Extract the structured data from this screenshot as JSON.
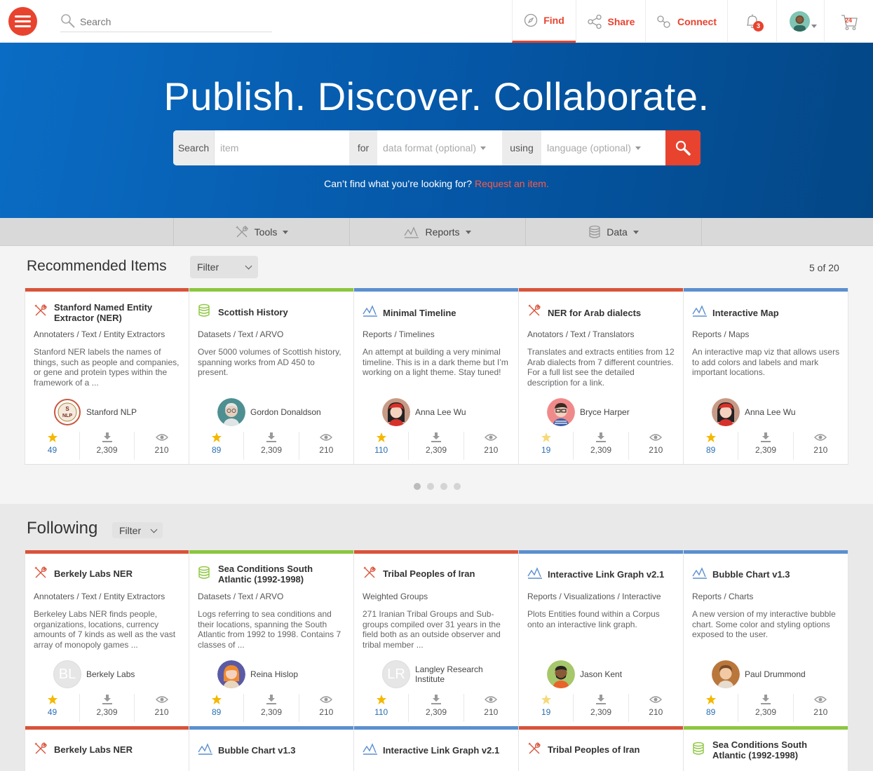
{
  "header": {
    "search_placeholder": "Search",
    "tabs": [
      {
        "label": "Find",
        "icon": "compass-icon"
      },
      {
        "label": "Share",
        "icon": "share-icon"
      },
      {
        "label": "Connect",
        "icon": "link-icon"
      }
    ],
    "notification_count": "3",
    "cart_count": "24"
  },
  "hero": {
    "title": "Publish. Discover. Collaborate.",
    "search_label": "Search",
    "item_placeholder": "item",
    "for_label": "for",
    "format_placeholder": "data format (optional)",
    "using_label": "using",
    "language_placeholder": "language (optional)",
    "note": "Can’t find what you’re looking for?",
    "note_link": "Request an item."
  },
  "categories": [
    {
      "label": "Tools",
      "icon": "tools-icon"
    },
    {
      "label": "Reports",
      "icon": "chart-line-icon"
    },
    {
      "label": "Data",
      "icon": "database-icon"
    }
  ],
  "recommended": {
    "title": "Recommended Items",
    "filter_label": "Filter",
    "counter": "5 of 20",
    "cards": [
      {
        "title": "Stanford Named Entity Extractor (NER)",
        "category": "Annotaters / Text / Entity Extractors",
        "desc": "Stanford NER labels the names of things, such as people and companies, or gene and protein types within the framework of a ...",
        "author": "Stanford NLP",
        "stars": "49",
        "downloads": "2,309",
        "views": "210"
      },
      {
        "title": "Scottish History",
        "category": "Datasets / Text / ARVO",
        "desc": "Over 5000 volumes of Scottish history, spanning works from AD 450 to present.",
        "author": "Gordon Donaldson",
        "stars": "89",
        "downloads": "2,309",
        "views": "210"
      },
      {
        "title": "Minimal Timeline",
        "category": "Reports / Timelines",
        "desc": "An attempt at building a very minimal timeline. This is in a dark theme but I’m working on a light theme. Stay tuned!",
        "author": "Anna Lee Wu",
        "stars": "110",
        "downloads": "2,309",
        "views": "210"
      },
      {
        "title": "NER for Arab dialects",
        "category": "Anotators / Text / Translators",
        "desc": "Translates and extracts entities from 12 Arab dialects from 7 different countries. For a full list see the detailed description for a link.",
        "author": "Bryce Harper",
        "stars": "19",
        "downloads": "2,309",
        "views": "210"
      },
      {
        "title": "Interactive Map",
        "category": "Reports / Maps",
        "desc": "An interactive map viz that allows users to add colors and labels and mark important locations.",
        "author": "Anna Lee Wu",
        "stars": "89",
        "downloads": "2,309",
        "views": "210"
      }
    ]
  },
  "following": {
    "title": "Following",
    "filter_label": "Filter",
    "cards": [
      {
        "title": "Berkely Labs NER",
        "category": "Annotaters / Text / Entity Extractors",
        "desc": "Berkeley Labs NER finds people, organizations, locations, currency amounts of 7 kinds as well as the vast array of monopoly games ...",
        "author": "Berkely Labs",
        "initials": "BL",
        "stars": "49",
        "downloads": "2,309",
        "views": "210"
      },
      {
        "title": "Sea Conditions South Atlantic (1992-1998)",
        "category": "Datasets / Text / ARVO",
        "desc": "Logs referring to sea conditions and their locations, spanning the South Atlantic from 1992 to 1998. Contains 7 classes of ...",
        "author": "Reina Hislop",
        "stars": "89",
        "downloads": "2,309",
        "views": "210"
      },
      {
        "title": "Tribal Peoples of Iran",
        "category": "Weighted Groups",
        "desc": "271 Iranian Tribal Groups and Sub-groups compiled over 31 years in the field both as an outside observer and tribal member ...",
        "author": "Langley Research Institute",
        "initials": "LR",
        "stars": "110",
        "downloads": "2,309",
        "views": "210"
      },
      {
        "title": "Interactive Link Graph v2.1",
        "category": "Reports / Visualizations / Interactive",
        "desc": "Plots Entities found within a Corpus onto an interactive link graph.",
        "author": "Jason Kent",
        "stars": "19",
        "downloads": "2,309",
        "views": "210"
      },
      {
        "title": "Bubble Chart v1.3",
        "category": "Reports / Charts",
        "desc": "A new version of my interactive bubble chart. Some color and styling options exposed to the user.",
        "author": "Paul Drummond",
        "stars": "89",
        "downloads": "2,309",
        "views": "210"
      }
    ],
    "next_row": [
      {
        "title": "Berkely Labs NER"
      },
      {
        "title": "Bubble Chart v1.3"
      },
      {
        "title": "Interactive Link Graph v2.1"
      },
      {
        "title": "Tribal Peoples of Iran"
      },
      {
        "title": "Sea Conditions South Atlantic (1992-1998)"
      }
    ]
  },
  "colors": {
    "tools": "#d9533a",
    "data": "#8cc63f",
    "reports": "#5b8fd0",
    "accent": "#e8432f"
  }
}
